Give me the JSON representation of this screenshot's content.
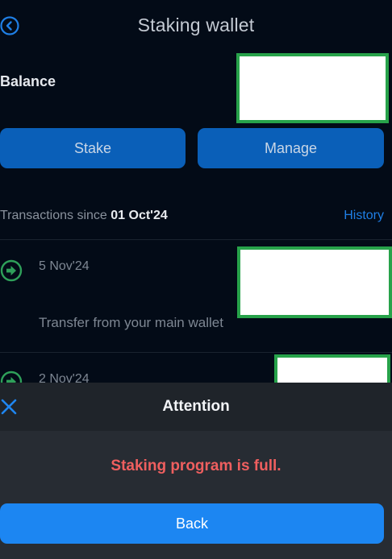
{
  "header": {
    "title": "Staking wallet",
    "back_icon": "back-arrow-circle-icon"
  },
  "balance": {
    "label": "Balance"
  },
  "actions": {
    "stake_label": "Stake",
    "manage_label": "Manage"
  },
  "transactions": {
    "since_prefix": "Transactions since ",
    "since_date": "01 Oct'24",
    "history_link": "History",
    "items": [
      {
        "date": "5 Nov'24",
        "description": "Transfer from your main wallet",
        "icon": "arrow-right-circle-icon"
      },
      {
        "date": "2 Nov'24",
        "icon": "arrow-right-circle-icon"
      }
    ]
  },
  "modal": {
    "title": "Attention",
    "message": "Staking program is full.",
    "back_label": "Back",
    "close_icon": "close-x-icon"
  },
  "colors": {
    "background": "#030b17",
    "primary_button": "#0a5fb8",
    "link_blue": "#1f7fe5",
    "tx_icon_green": "#2fa05a",
    "error_red": "#ef5f5f",
    "modal_button": "#1c86f2",
    "redaction_border": "#27a24a"
  }
}
